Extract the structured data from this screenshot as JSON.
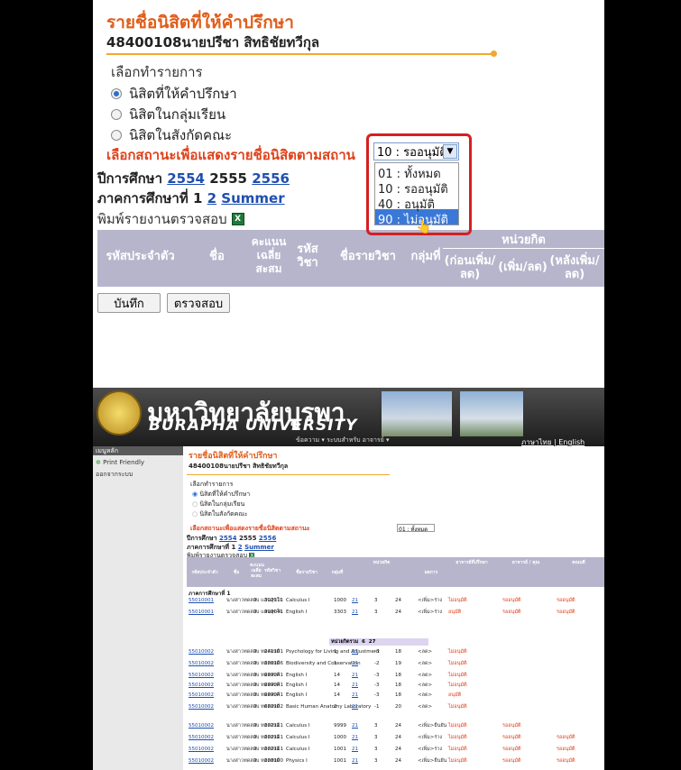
{
  "top": {
    "title": "รายชื่อนิสิตที่ให้คำปรึกษา",
    "advisor": "48400108นายปรีชา สิทธิชัยทวีกุล",
    "choose_label": "เลือกทำรายการ",
    "options": [
      "นิสิตที่ให้คำปรึกษา",
      "นิสิตในกลุ่มเรียน",
      "นิสิตในสังกัดคณะ"
    ],
    "status_label": "เลือกสถานะเพื่อแสดงรายชื่อนิสิตตามสถานะ",
    "status_visible": "เลือกสถานะเพื่อแสดงรายชื่อนิสิตตามสถาน",
    "year_label": "ปีการศึกษา",
    "years": [
      "2554",
      "2555",
      "2556"
    ],
    "term_label": "ภาคการศึกษาที่",
    "terms": [
      "1",
      "2",
      "Summer"
    ],
    "print_label": "พิมพ์รายงานตรวจสอบ",
    "select_value": "10 : รออนุมัติ",
    "dropdown_options": [
      "01 : ทั้งหมด",
      "10 : รออนุมัติ",
      "40 : อนุมัติ",
      "90 : ไม่อนุมัติ"
    ],
    "table_headers": {
      "student_id": "รหัสประจำตัว",
      "name": "ชื่อ",
      "gpa": "คะแนนเฉลี่ยสะสม",
      "course_code": "รหัสวิชา",
      "course_name": "ชื่อรายวิชา",
      "group": "กลุ่มที่",
      "credits": "หน่วยกิต",
      "before": "(ก่อนเพิ่ม/ลด)",
      "change": "(เพิ่ม/ลด)",
      "after": "(หลังเพิ่ม/ลด)"
    },
    "save_button": "บันทึก",
    "check_button": "ตรวจสอบ"
  },
  "bottom": {
    "university_th": "มหาวิทยาลัยบูรพา",
    "university_en": "BURAPHA UNIVERSITY",
    "top_menu": "ข้อความ ▾  ระบบสำหรับ อาจารย์ ▾",
    "lang": "ภาษาไทย | English",
    "sidebar_head": "เมนูหลัก",
    "sidebar_items": [
      "Print Friendly",
      "ออกจากระบบ"
    ],
    "title": "รายชื่อนิสิตที่ให้คำปรึกษา",
    "advisor": "48400108นายปรีชา สิทธิชัยทวีกุล",
    "choose_label": "เลือกทำรายการ",
    "options": [
      "นิสิตที่ให้คำปรึกษา",
      "นิสิตในกลุ่มเรียน",
      "นิสิตในสังกัดคณะ"
    ],
    "status_label": "เลือกสถานะเพื่อแสดงรายชื่อนิสิตตามสถานะ",
    "status_value": "01 : ทั้งหมด",
    "year_label": "ปีการศึกษา",
    "years": [
      "2554",
      "2555",
      "2556"
    ],
    "term_label": "ภาคการศึกษาที่",
    "terms": [
      "1",
      "2",
      "Summer"
    ],
    "print_label": "พิมพ์รายงานตรวจสอบ",
    "table_headers": {
      "student_id": "รหัสประจำตัว",
      "name": "ชื่อ",
      "gpa": "คะแนนเฉลี่ยสะสม",
      "course_code": "รหัสวิชา",
      "course_name": "ชื่อรายวิชา",
      "group": "กลุ่มที่",
      "credits": "หน่วยกิต",
      "result": "ผลการ",
      "advisor": "อาจารย์ที่ปรึกษา",
      "dept": "อาจารย์ / คุณ",
      "dean": "คณบดี"
    },
    "term_row": "ภาคการศึกษาที่ 1",
    "subtotal_label": "หน่วยกิตรวม",
    "subtotal_values": [
      "6",
      "27"
    ],
    "rows": [
      {
        "id": "55010001",
        "name": "นางสาวทดสอบ แสนสุขใจ",
        "gpa": "0",
        "code": "302111",
        "course": "Calculus I",
        "sec": "1000",
        "c1": "21",
        "c2": "3",
        "c3": "24",
        "rs": "<เพิ่ม>ร่าง",
        "a1": "ไม่อนุมัติ",
        "a2": "รออนุมัติ",
        "a3": "รออนุมัติ"
      },
      {
        "id": "55010001",
        "name": "นางสาวทดสอบ แสนสุขใจ",
        "gpa": "0",
        "code": "999041",
        "course": "English I",
        "sec": "3303",
        "c1": "21",
        "c2": "3",
        "c3": "24",
        "rs": "<เพิ่ม>ร่าง",
        "a1": "อนุมัติ",
        "a2": "รออนุมัติ",
        "a3": "รออนุมัติ"
      },
      {
        "id": "55010002",
        "name": "นางสาวทดสอบ ทดสอบดี",
        "gpa": "0",
        "code": "241101",
        "course": "Psychology for Living and Adjustment",
        "sec": "1",
        "c1": "21",
        "c2": "-3",
        "c3": "18",
        "rs": "<ลด>",
        "a1": "ไม่อนุมัติ",
        "a2": "",
        "a3": ""
      },
      {
        "id": "55010002",
        "name": "นางสาวทดสอบ ทดสอบดี",
        "gpa": "0",
        "code": "306106",
        "course": "Biodiversity and Conservation",
        "sec": "1",
        "c1": "21",
        "c2": "-2",
        "c3": "19",
        "rs": "<ลด>",
        "a1": "ไม่อนุมัติ",
        "a2": "",
        "a3": ""
      },
      {
        "id": "55010002",
        "name": "นางสาวทดสอบ ทดสอบดี",
        "gpa": "0",
        "code": "999041",
        "course": "English I",
        "sec": "14",
        "c1": "21",
        "c2": "-3",
        "c3": "18",
        "rs": "<ลด>",
        "a1": "ไม่อนุมัติ",
        "a2": "",
        "a3": ""
      },
      {
        "id": "55010002",
        "name": "นางสาวทดสอบ ทดสอบดี",
        "gpa": "0",
        "code": "999041",
        "course": "English I",
        "sec": "14",
        "c1": "21",
        "c2": "-3",
        "c3": "18",
        "rs": "<ลด>",
        "a1": "ไม่อนุมัติ",
        "a2": "",
        "a3": ""
      },
      {
        "id": "55010002",
        "name": "นางสาวทดสอบ ทดสอบดี",
        "gpa": "0",
        "code": "999041",
        "course": "English I",
        "sec": "14",
        "c1": "21",
        "c2": "-3",
        "c3": "18",
        "rs": "<ลด>",
        "a1": "อนุมัติ",
        "a2": "",
        "a3": ""
      },
      {
        "id": "55010002",
        "name": "นางสาวทดสอบ ทดสอบดี",
        "gpa": "0",
        "code": "680102",
        "course": "Basic Human Anatomy Laboratory",
        "sec": "2",
        "c1": "21",
        "c2": "-1",
        "c3": "20",
        "rs": "<ลด>",
        "a1": "ไม่อนุมัติ",
        "a2": "",
        "a3": ""
      },
      {
        "id": "55010002",
        "name": "นางสาวทดสอบ ทดสอบดี",
        "gpa": "0",
        "code": "302111",
        "course": "Calculus I",
        "sec": "9999",
        "c1": "21",
        "c2": "3",
        "c3": "24",
        "rs": "<เพิ่ม>ยืนยัน",
        "a1": "ไม่อนุมัติ",
        "a2": "รออนุมัติ",
        "a3": ""
      },
      {
        "id": "55010002",
        "name": "นางสาวทดสอบ ทดสอบดี",
        "gpa": "0",
        "code": "302111",
        "course": "Calculus I",
        "sec": "1000",
        "c1": "21",
        "c2": "3",
        "c3": "24",
        "rs": "<เพิ่ม>ร่าง",
        "a1": "ไม่อนุมัติ",
        "a2": "รออนุมัติ",
        "a3": "รออนุมัติ"
      },
      {
        "id": "55010002",
        "name": "นางสาวทดสอบ ทดสอบดี",
        "gpa": "0",
        "code": "302111",
        "course": "Calculus I",
        "sec": "1001",
        "c1": "21",
        "c2": "3",
        "c3": "24",
        "rs": "<เพิ่ม>ร่าง",
        "a1": "ไม่อนุมัติ",
        "a2": "รออนุมัติ",
        "a3": "รออนุมัติ"
      },
      {
        "id": "55010002",
        "name": "นางสาวทดสอบ ทดสอบดี",
        "gpa": "0",
        "code": "308100",
        "course": "Physics I",
        "sec": "1001",
        "c1": "21",
        "c2": "3",
        "c3": "24",
        "rs": "<เพิ่ม>ยืนยัน",
        "a1": "ไม่อนุมัติ",
        "a2": "รออนุมัติ",
        "a3": "รออนุมัติ"
      }
    ]
  },
  "colors": {
    "title": "#e05d1a",
    "status": "#e0411a",
    "link": "#1f4fb0",
    "header_bg": "#b7b5cc",
    "highlight": "#3a78d8",
    "callout": "#d42020"
  }
}
